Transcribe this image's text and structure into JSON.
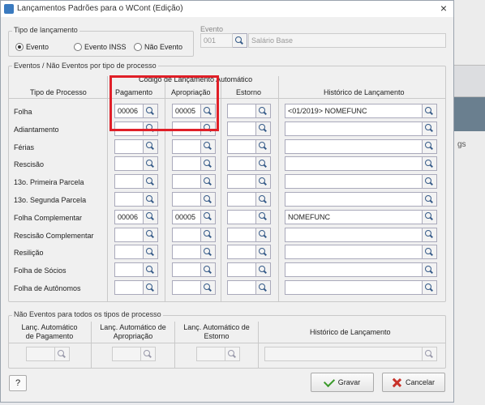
{
  "window": {
    "title": "Lançamentos Padrões para o WCont (Edição)",
    "close": "×"
  },
  "background": {
    "page_text": "gs"
  },
  "tipo": {
    "label": "Tipo de lançamento",
    "options": [
      "Evento",
      "Evento INSS",
      "Não Evento"
    ],
    "selected": "Evento"
  },
  "evento": {
    "label": "Evento",
    "code": "001",
    "description": "Salário Base"
  },
  "eventos": {
    "label": "Eventos / Não Eventos por tipo de processo",
    "group_header": "Código de Lançamento Automático",
    "columns": {
      "tipo": "Tipo de Processo",
      "pagamento": "Pagamento",
      "apropriacao": "Apropriação",
      "estorno": "Estorno",
      "historico": "Histórico de Lançamento"
    },
    "rows": [
      {
        "tipo": "Folha",
        "pagamento": "00006",
        "apropriacao": "00005",
        "estorno": "",
        "historico": "<01/2019> NOMEFUNC"
      },
      {
        "tipo": "Adiantamento",
        "pagamento": "",
        "apropriacao": "",
        "estorno": "",
        "historico": ""
      },
      {
        "tipo": "Férias",
        "pagamento": "",
        "apropriacao": "",
        "estorno": "",
        "historico": ""
      },
      {
        "tipo": "Rescisão",
        "pagamento": "",
        "apropriacao": "",
        "estorno": "",
        "historico": ""
      },
      {
        "tipo": "13o. Primeira Parcela",
        "pagamento": "",
        "apropriacao": "",
        "estorno": "",
        "historico": ""
      },
      {
        "tipo": "13o. Segunda Parcela",
        "pagamento": "",
        "apropriacao": "",
        "estorno": "",
        "historico": ""
      },
      {
        "tipo": "Folha Complementar",
        "pagamento": "00006",
        "apropriacao": "00005",
        "estorno": "",
        "historico": "NOMEFUNC"
      },
      {
        "tipo": "Rescisão Complementar",
        "pagamento": "",
        "apropriacao": "",
        "estorno": "",
        "historico": ""
      },
      {
        "tipo": "Resilição",
        "pagamento": "",
        "apropriacao": "",
        "estorno": "",
        "historico": ""
      },
      {
        "tipo": "Folha de Sócios",
        "pagamento": "",
        "apropriacao": "",
        "estorno": "",
        "historico": ""
      },
      {
        "tipo": "Folha de Autônomos",
        "pagamento": "",
        "apropriacao": "",
        "estorno": "",
        "historico": ""
      }
    ]
  },
  "nao_eventos": {
    "label": "Não Eventos para todos os tipos de processo",
    "columns": {
      "pagamento": "Lanç. Automático de Pagamento",
      "apropriacao": "Lanç. Automático de Apropriação",
      "estorno": "Lanç. Automático de Estorno",
      "historico": "Histórico de Lançamento"
    }
  },
  "buttons": {
    "help": "?",
    "gravar": "Gravar",
    "cancelar": "Cancelar"
  }
}
